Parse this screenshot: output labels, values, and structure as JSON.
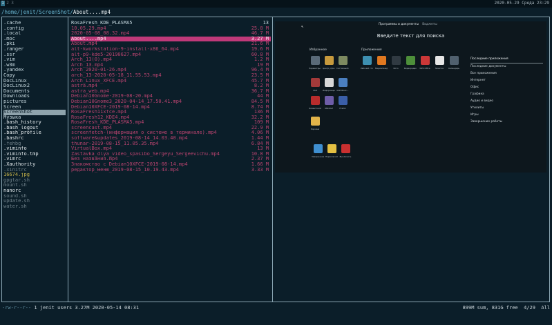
{
  "workspaces": [
    "1",
    "2",
    "3"
  ],
  "clock": "2020-05-29 Среда 23:29",
  "path": {
    "dir": "/home/jenit/ScreenShot/",
    "file": "About....mp4"
  },
  "column1": [
    {
      "name": ".cache",
      "style": "dir"
    },
    {
      "name": ".config",
      "style": "dir"
    },
    {
      "name": ".local",
      "style": "dir"
    },
    {
      "name": ".moc",
      "style": "dir"
    },
    {
      "name": ".pki",
      "style": "dir"
    },
    {
      "name": ".ranger",
      "style": "dir"
    },
    {
      "name": ".ssr",
      "style": "dir"
    },
    {
      "name": ".vim",
      "style": "dir"
    },
    {
      "name": ".w3m",
      "style": "dir"
    },
    {
      "name": ".yandex",
      "style": "dir"
    },
    {
      "name": "Copy",
      "style": "dir"
    },
    {
      "name": "DocLinux",
      "style": "dir"
    },
    {
      "name": "DocLinux2",
      "style": "dir"
    },
    {
      "name": "Documents",
      "style": "dir"
    },
    {
      "name": "Downloads",
      "style": "dir"
    },
    {
      "name": "pictures",
      "style": "dir"
    },
    {
      "name": "Screen",
      "style": "dir"
    },
    {
      "name": "ScreenShot",
      "style": "sel-grey"
    },
    {
      "name": "Музыка",
      "style": "dir"
    },
    {
      "name": ".bash_history",
      "style": "white"
    },
    {
      "name": ".bash_logout",
      "style": "white"
    },
    {
      "name": ".bash_profile",
      "style": "white"
    },
    {
      "name": ".bashrc",
      "style": "white"
    },
    {
      "name": ".fehbg",
      "style": "dim"
    },
    {
      "name": ".viminfo",
      "style": "white"
    },
    {
      "name": ".viminfo.tmp",
      "style": "white"
    },
    {
      "name": ".vimrc",
      "style": "white"
    },
    {
      "name": ".Xauthority",
      "style": "white"
    },
    {
      "name": ".xinitrc",
      "style": "dim"
    },
    {
      "name": "16674.jpg",
      "style": "yellow"
    },
    {
      "name": "gpgtar.sh",
      "style": "dim"
    },
    {
      "name": "mount.sh",
      "style": "dim"
    },
    {
      "name": "nanorc",
      "style": "white"
    },
    {
      "name": "sound.sh",
      "style": "dim"
    },
    {
      "name": "update.sh",
      "style": "dim"
    },
    {
      "name": "water.sh",
      "style": "dim"
    }
  ],
  "column2": [
    {
      "name": "RosaFresh_KDE_PLASMA5",
      "size": "13",
      "style": "dir"
    },
    {
      "name": "10.05.29.mp4",
      "size": "25.8 M",
      "style": "mp4"
    },
    {
      "name": "2020-05-08_08.32.mp4",
      "size": "46.7 M",
      "style": "mp4"
    },
    {
      "name": "About....mp4",
      "size": "3.27 M",
      "style": "sel-mag"
    },
    {
      "name": "About.mp4",
      "size": "21.6 M",
      "style": "mp4"
    },
    {
      "name": "alt-kworkstation-9-install-x86_64.mp4",
      "size": "19.6 M",
      "style": "mp4"
    },
    {
      "name": "alt-p9-kde5-20190627.mp4",
      "size": "60.8 M",
      "style": "mp4"
    },
    {
      "name": "Arch_13(0).mp4",
      "size": "1.2 M",
      "style": "mp4"
    },
    {
      "name": "Arch_13.mp4",
      "size": "19 M",
      "style": "mp4"
    },
    {
      "name": "Arch_2020-01-26.mp4",
      "size": "96.4 M",
      "style": "mp4"
    },
    {
      "name": "arch_13-2020-05-18_11.55.53.mp4",
      "size": "23.5 M",
      "style": "mp4"
    },
    {
      "name": "Arch_Linux_XFCE.mp4",
      "size": "45.7 M",
      "style": "mp4"
    },
    {
      "name": "astra.mp4",
      "size": "8.2 M",
      "style": "mp4"
    },
    {
      "name": "astra_web.mp4",
      "size": "36.7 M",
      "style": "mp4"
    },
    {
      "name": "Debian10Gnome-2019-08-20.mp4",
      "size": "44 M",
      "style": "mp4"
    },
    {
      "name": "Debian10Gnome3_2020-04-14_17.50.41.mp4",
      "size": "84.5 M",
      "style": "mp4"
    },
    {
      "name": "Debian10XFCE-2019-08-14.mp4",
      "size": "8.74 M",
      "style": "mp4"
    },
    {
      "name": "RosaFresh11xfce.mp4",
      "size": "136 M",
      "style": "mp4"
    },
    {
      "name": "RosaFresh12_KDE4.mp4",
      "size": "32.2 M",
      "style": "mp4"
    },
    {
      "name": "RosaFresh_KDE_PLASMA5.mp4",
      "size": "109 M",
      "style": "mp4"
    },
    {
      "name": "screencast.mp4",
      "size": "22.9 M",
      "style": "mp4"
    },
    {
      "name": "screenfetch-(информация о системе в терминале).mp4",
      "size": "4.06 M",
      "style": "mp4"
    },
    {
      "name": "software&updates_2019-08-14_14.03.40.mp4",
      "size": "1.44 M",
      "style": "mp4"
    },
    {
      "name": "thunar-2019-08-15_11.05.35.mp4",
      "size": "6.84 M",
      "style": "mp4"
    },
    {
      "name": "VirtualBox.mp4",
      "size": "13 M",
      "style": "mp4"
    },
    {
      "name": "Zastavka_dlya_video_spasibo_Sergeyu_Sergeevichu.mp4",
      "size": "10.8 M",
      "style": "mp4"
    },
    {
      "name": "Без названия.mp4",
      "size": "2.37 M",
      "style": "mp4"
    },
    {
      "name": "Знакомство с Debian10XFCE-2019-08-14.mp4",
      "size": "1.66 M",
      "style": "mp4"
    },
    {
      "name": "редактор_меню_2019-08-15_10.19.43.mp4",
      "size": "3.33 M",
      "style": "mp4"
    }
  ],
  "preview": {
    "top_tabs": [
      "Программы и документы",
      "Виджеты"
    ],
    "search_text": "Введите текст для поиска",
    "favorites_label": "Избранное",
    "apps_label": "Приложения",
    "menu": [
      "Последние приложения",
      "Последние документы",
      "Все приложения",
      "Интернет",
      "Офис",
      "Графика",
      "Аудио и видео",
      "Утилиты",
      "Игры",
      "Завершение работы"
    ],
    "fav_icons": [
      {
        "label": "Параметры с...",
        "color": "#5a6a78"
      },
      {
        "label": "Центр упра...",
        "color": "#c79a3d"
      },
      {
        "label": "Системный м...",
        "color": "#7d8a60"
      },
      {
        "label": "rDef",
        "color": "#a33a3a"
      },
      {
        "label": "Информация ...",
        "color": "#d8d8d8"
      },
      {
        "label": "KDE Block...",
        "color": "#4a7fc0"
      },
      {
        "label": "Клиентский м...",
        "color": "#b82c2c"
      },
      {
        "label": "KMixDef",
        "color": "#6e5da8"
      },
      {
        "label": "Firefox",
        "color": "#3b5fa8"
      },
      {
        "label": "Корзина",
        "color": "#e2b44a"
      },
      {
        "label": "Завершение ра...",
        "color": "#3f8fd0"
      },
      {
        "label": "Переключить ...",
        "color": "#e3c042"
      },
      {
        "label": "Выключить",
        "color": "#c93030"
      }
    ],
    "app_icons": [
      {
        "label": "Рабочий стол",
        "color": "#3d8fb0"
      },
      {
        "label": "Медиаплеер",
        "color": "#e07820"
      },
      {
        "label": "Фото",
        "color": "#303a42"
      },
      {
        "label": "Видеоредакт.",
        "color": "#4d8f3a"
      },
      {
        "label": "WPS Office",
        "color": "#cc3838"
      },
      {
        "label": "Заметки",
        "color": "#e6e6e6"
      },
      {
        "label": "Календарь",
        "color": "#50606e"
      }
    ]
  },
  "status": {
    "permissions": "-rw-r--r--",
    "info": " 1 jenit users 3.27M 2020-05-14 08:31",
    "summary": "899M sum, 831G free  4/29  All"
  }
}
